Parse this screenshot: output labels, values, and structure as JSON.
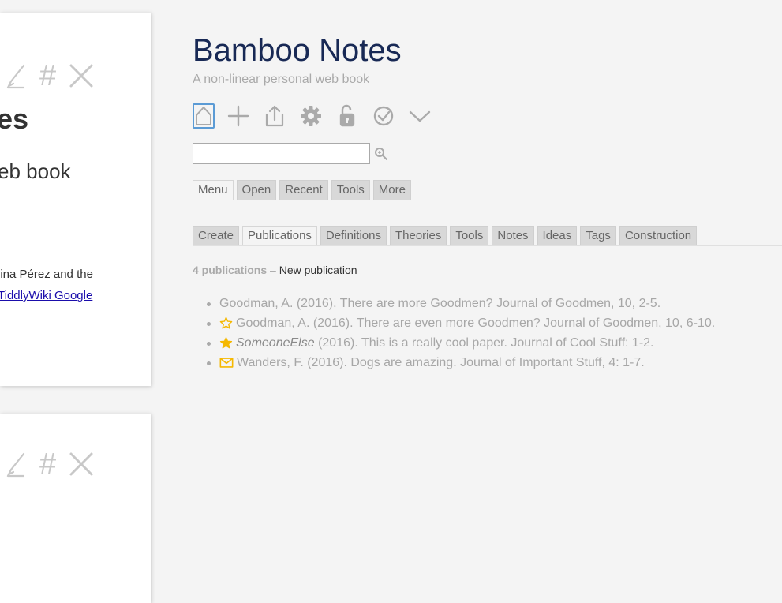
{
  "story": {
    "tiddler1": {
      "title_fragment": "es",
      "subtitle_fragment": "eb book",
      "body_line1": "lina Pérez and the",
      "body_link": "TiddlyWiki Google"
    }
  },
  "sidebar": {
    "title": "Bamboo Notes",
    "subtitle": "A non-linear personal web book",
    "page_controls": [
      "home-icon",
      "new-tiddler-icon",
      "export-icon",
      "control-panel-icon",
      "unlock-icon",
      "check-icon",
      "more-chevron-icon"
    ],
    "search": {
      "value": "",
      "placeholder": ""
    },
    "main_tabs": [
      "Menu",
      "Open",
      "Recent",
      "Tools",
      "More"
    ],
    "main_tabs_active": "Menu",
    "sub_tabs": [
      "Create",
      "Publications",
      "Definitions",
      "Theories",
      "Tools",
      "Notes",
      "Ideas",
      "Tags",
      "Construction"
    ],
    "sub_tabs_active": "Publications",
    "publications": {
      "count_label": "4 publications",
      "separator": "–",
      "new_label": "New publication",
      "items": [
        {
          "icon": "",
          "author": "",
          "text": "Goodman, A. (2016). There are more Goodmen? Journal of Goodmen, 10, 2-5."
        },
        {
          "icon": "star-outline-icon",
          "author": "",
          "text": "Goodman, A. (2016). There are even more Goodmen? Journal of Goodmen, 10, 6-10."
        },
        {
          "icon": "star-filled-icon",
          "author": "SomeoneElse",
          "text": " (2016). This is a really cool paper. Journal of Cool Stuff: 1-2."
        },
        {
          "icon": "envelope-icon",
          "author": "",
          "text": "Wanders, F. (2016). Dogs are amazing. Journal of Important Stuff, 4: 1-7."
        }
      ]
    }
  },
  "colors": {
    "title": "#182955",
    "muted": "#aaaaaa",
    "star": "#f5b800",
    "focus": "#5b9bd5"
  }
}
